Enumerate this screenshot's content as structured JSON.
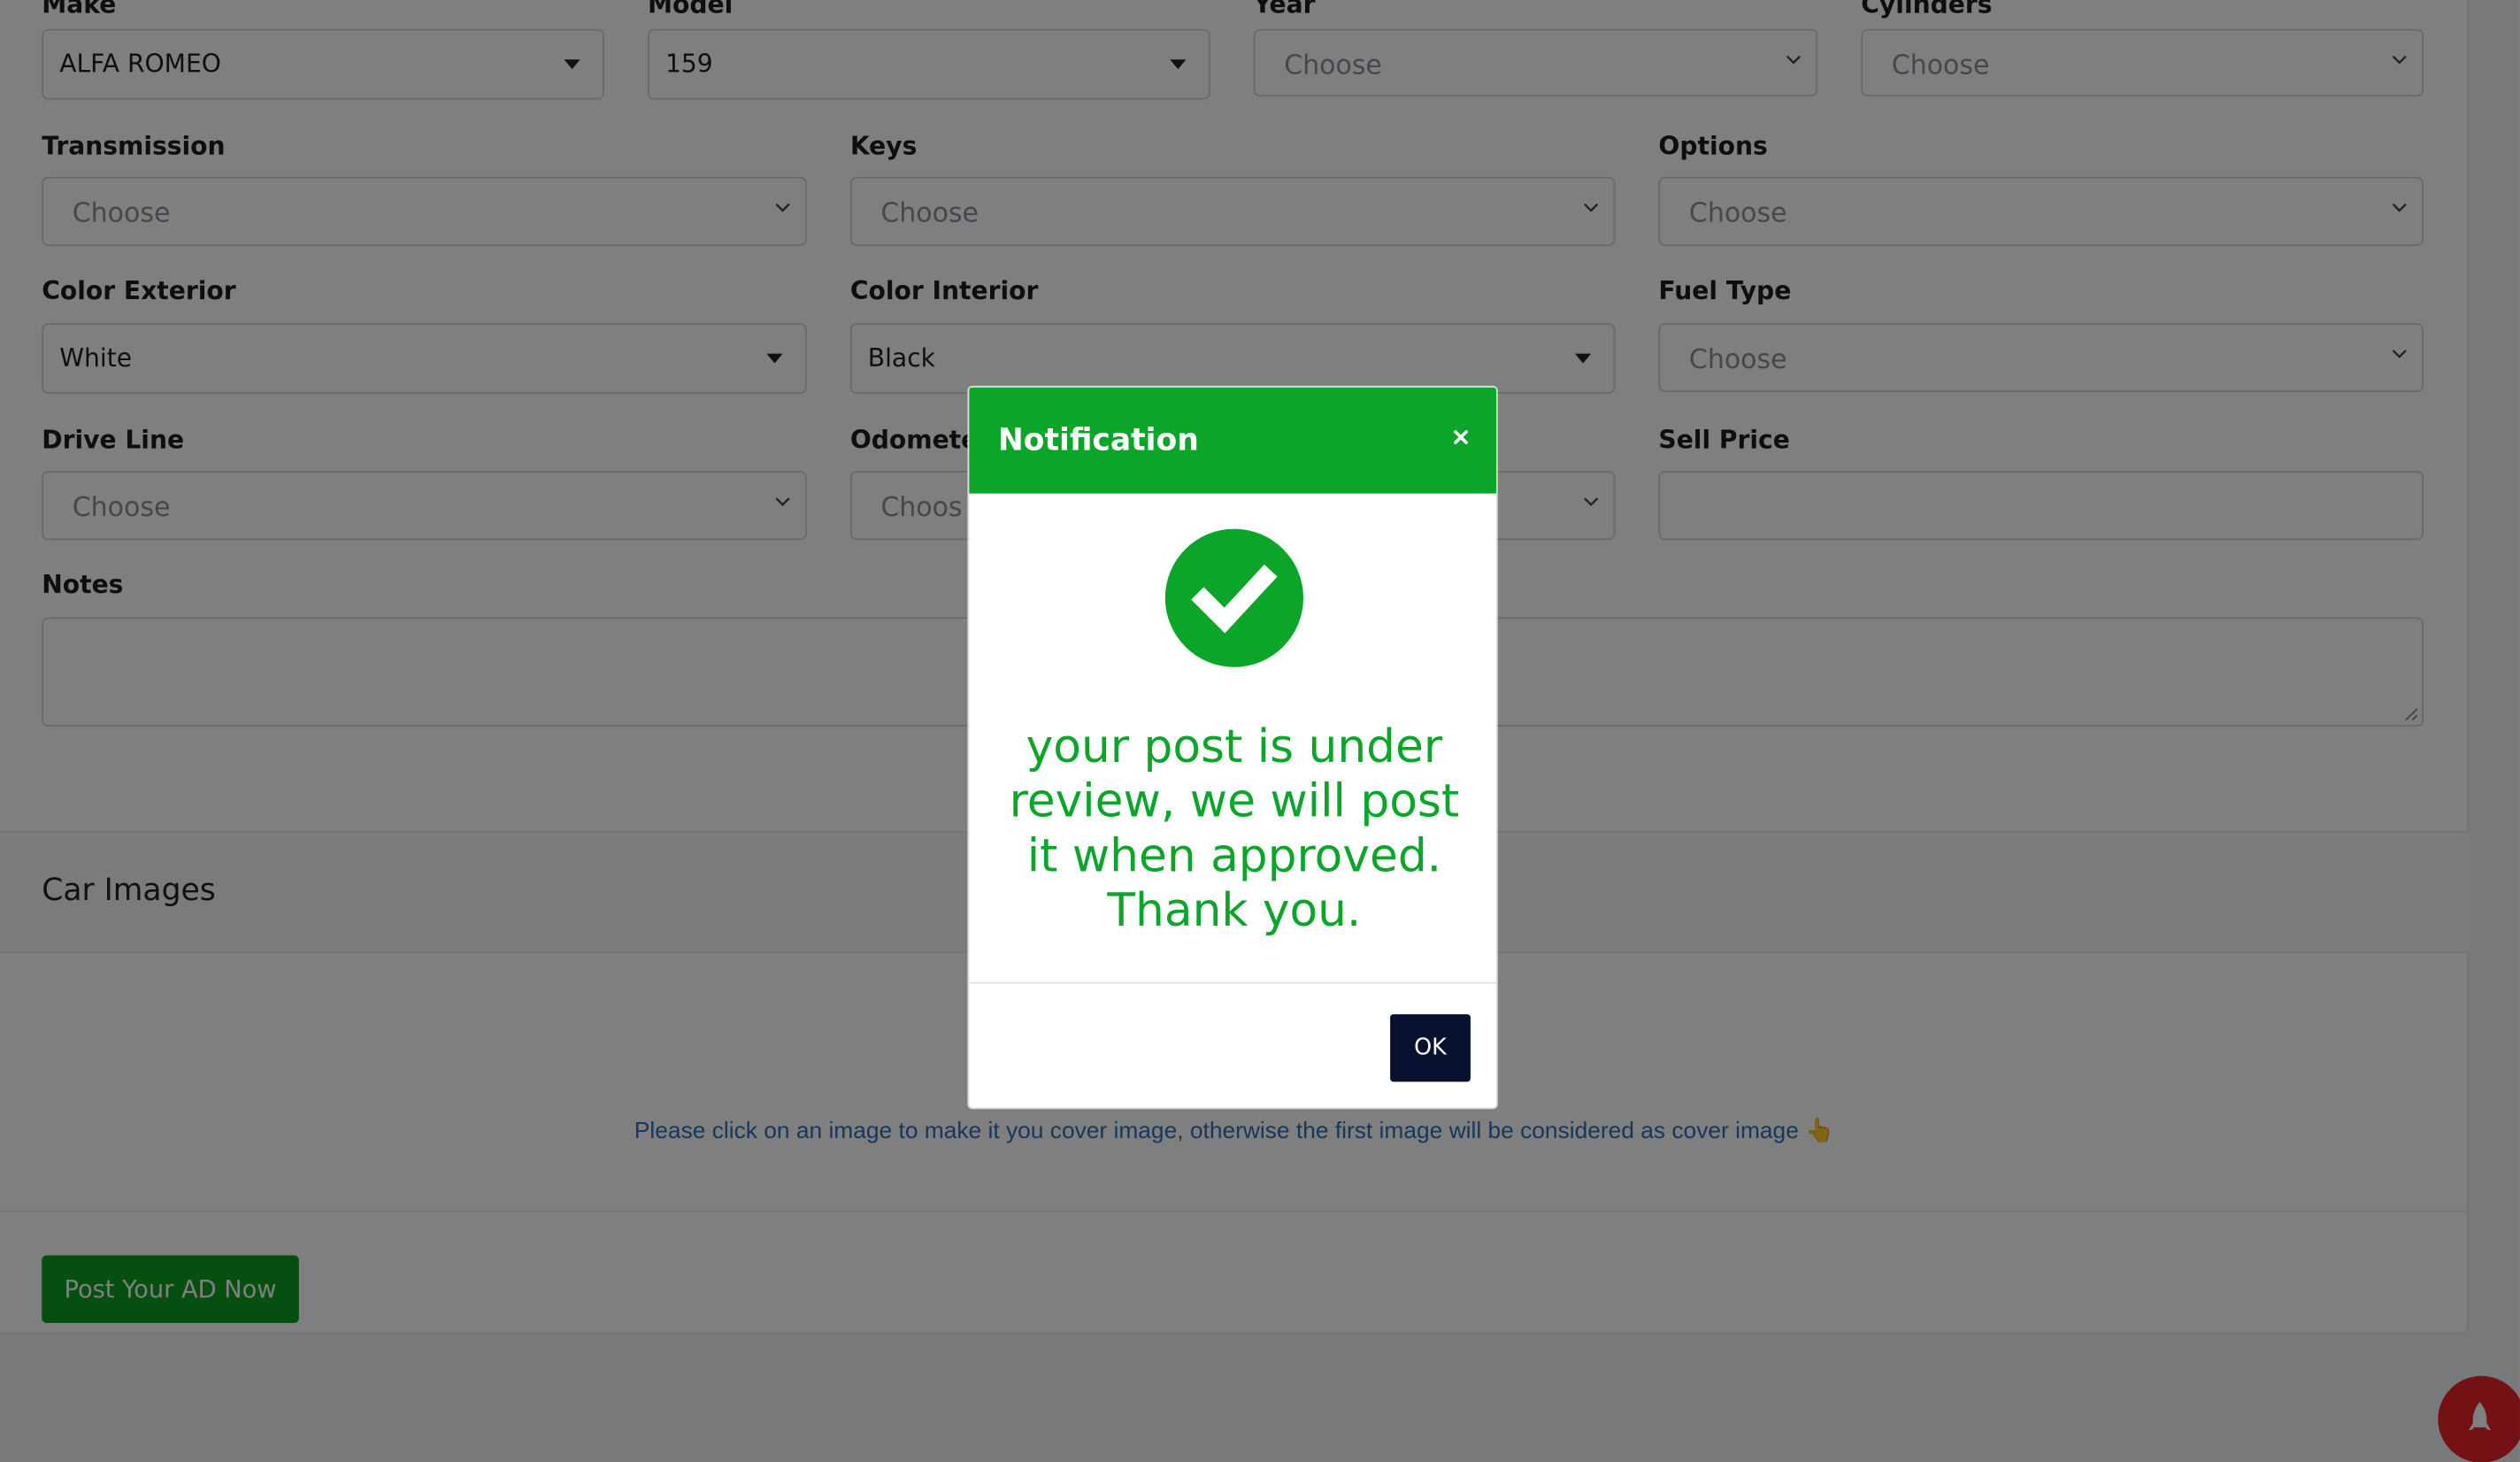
{
  "form": {
    "top_row": [
      {
        "label": "Make",
        "value": "ALFA ROMEO",
        "filled": true
      },
      {
        "label": "Model",
        "value": "159",
        "filled": true
      },
      {
        "label": "Year",
        "value": "Choose",
        "filled": false
      },
      {
        "label": "Cylinders",
        "value": "Choose",
        "filled": false
      }
    ],
    "transmission": {
      "label": "Transmission",
      "value": "Choose"
    },
    "keys": {
      "label": "Keys",
      "value": "Choose"
    },
    "options": {
      "label": "Options",
      "value": "Choose"
    },
    "color_exterior": {
      "label": "Color Exterior",
      "value": "White"
    },
    "color_interior": {
      "label": "Color Interior",
      "value": "Black"
    },
    "fuel_type": {
      "label": "Fuel Type",
      "value": "Choose"
    },
    "drive_line": {
      "label": "Drive Line",
      "value": "Choose"
    },
    "odometer": {
      "label": "Odomete",
      "value": "Choos"
    },
    "sell_price": {
      "label": "Sell Price",
      "value": ""
    },
    "notes": {
      "label": "Notes",
      "value": ""
    }
  },
  "car_images": {
    "heading": "Car Images",
    "hint": "Please click on an image to make it you cover image, otherwise the first image will be considered as cover image 👆"
  },
  "post_button": "Post Your AD Now",
  "modal": {
    "title": "Notification",
    "close_icon": "close-icon",
    "message": "your post is under review, we will post it when approved. Thank you.",
    "ok_label": "OK"
  },
  "fab_icon": "rocket-icon",
  "colors": {
    "accent_green": "#0ba52a",
    "button_green": "#0b9e23",
    "ok_navy": "#081230",
    "fab_red": "#e9222b",
    "hint_blue": "#2f6fb6"
  }
}
